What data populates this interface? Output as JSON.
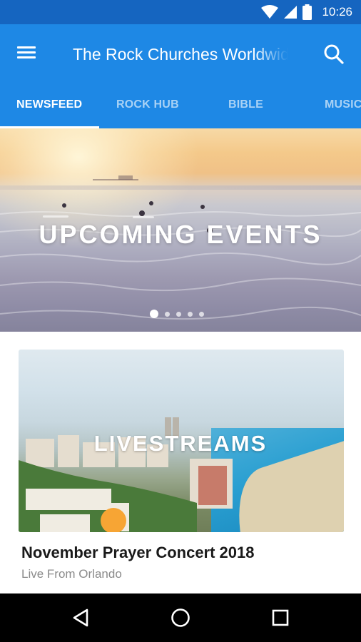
{
  "status_bar": {
    "time": "10:26",
    "icons": [
      "wifi-icon",
      "cell-signal-icon",
      "battery-icon"
    ]
  },
  "app_bar": {
    "title": "The Rock Churches Worldwide",
    "menu_icon": "menu-icon",
    "search_icon": "search-icon"
  },
  "tabs": [
    {
      "label": "NEWSFEED",
      "active": true
    },
    {
      "label": "ROCK HUB",
      "active": false
    },
    {
      "label": "BIBLE",
      "active": false
    },
    {
      "label": "MUSIC",
      "active": false
    }
  ],
  "hero": {
    "title": "UPCOMING EVENTS",
    "page_count": 5,
    "active_page": 1
  },
  "card": {
    "overlay_label": "LIVESTREAMS",
    "title": "November Prayer Concert 2018",
    "subtitle": "Live From Orlando"
  },
  "nav_bar": {
    "buttons": [
      "back-icon",
      "home-icon",
      "recents-icon"
    ]
  },
  "colors": {
    "status_bar": "#1565c0",
    "primary": "#1e88e5",
    "tab_inactive": "rgba(255,255,255,0.62)",
    "nav_bar": "#000000"
  }
}
